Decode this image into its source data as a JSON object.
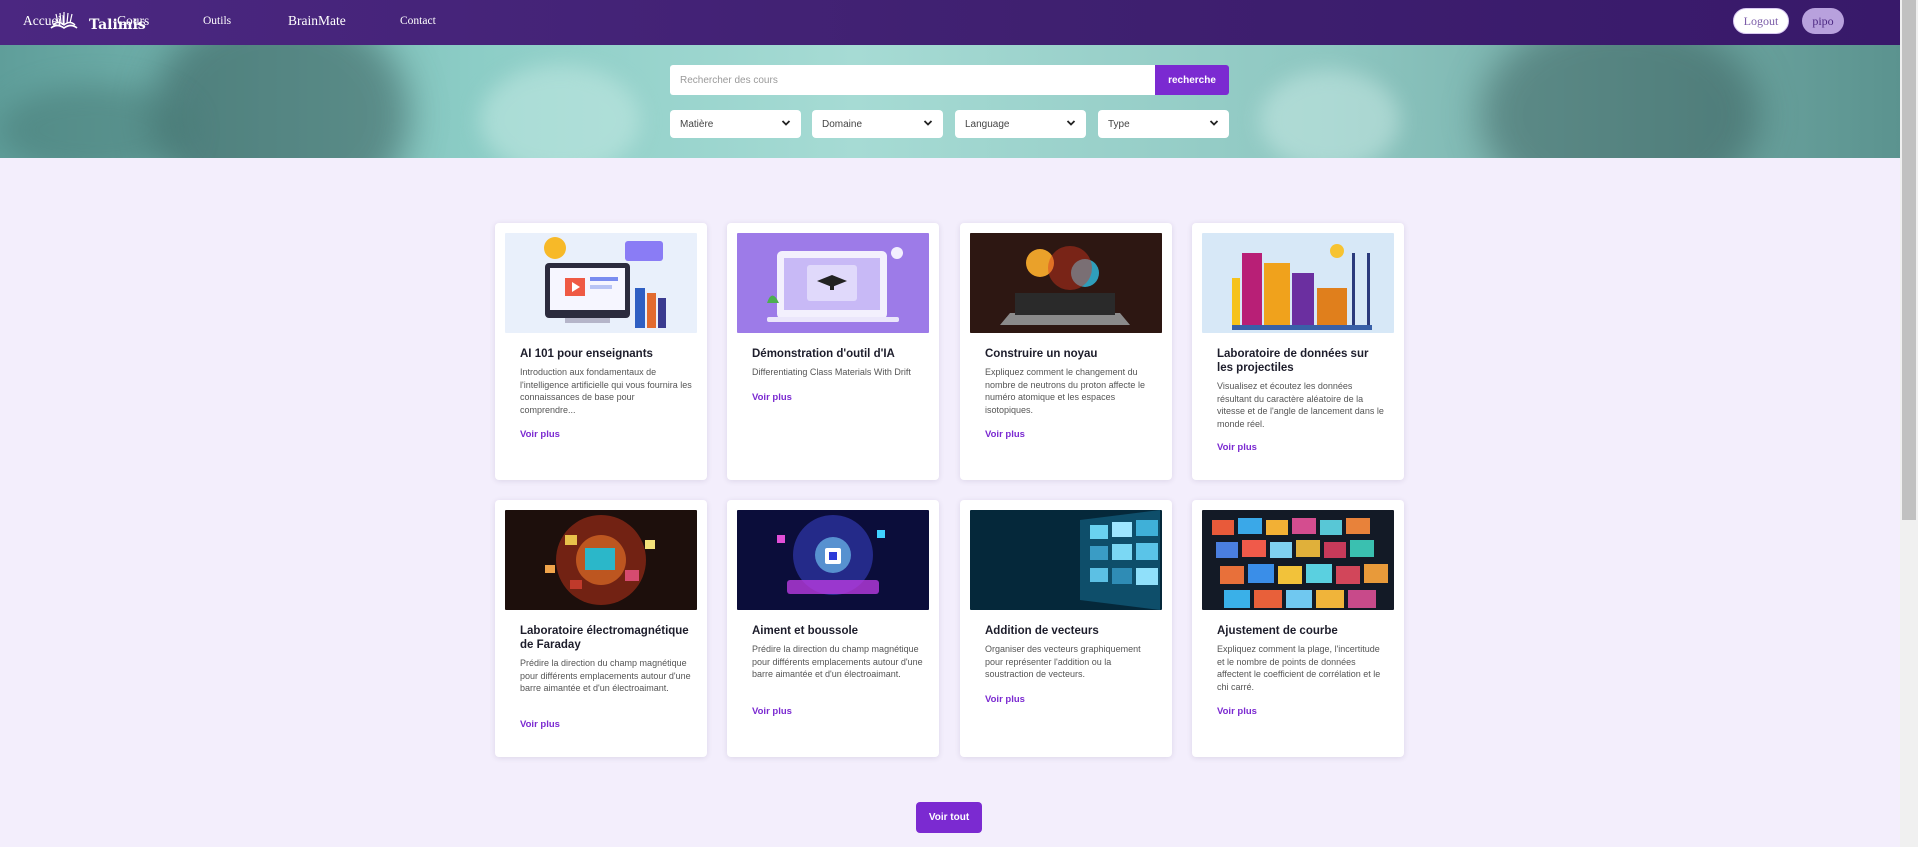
{
  "brand": {
    "name": "Talimis",
    "logo_icon": "book-icon"
  },
  "nav": {
    "items": [
      {
        "label": "Accueil",
        "size": "big"
      },
      {
        "label": "Cours",
        "size": "big"
      },
      {
        "label": "Outils",
        "size": "small"
      },
      {
        "label": "BrainMate",
        "size": "big"
      },
      {
        "label": "Contact",
        "size": "small"
      }
    ],
    "logout_label": "Logout",
    "user_label": "pipo"
  },
  "search": {
    "placeholder": "Rechercher des cours",
    "button_label": "recherche"
  },
  "filters": [
    {
      "label": "Matière",
      "icon": "chevron-down-icon"
    },
    {
      "label": "Domaine",
      "icon": "chevron-down-icon"
    },
    {
      "label": "Language",
      "icon": "chevron-down-icon"
    },
    {
      "label": "Type",
      "icon": "chevron-down-icon"
    }
  ],
  "courses": [
    {
      "title": "AI 101 pour enseignants",
      "description": "Introduction aux fondamentaux de l'intelligence artificielle qui vous fournira les connaissances de base pour comprendre...",
      "link": "Voir plus"
    },
    {
      "title": "Démonstration d'outil d'IA",
      "description": "Differentiating Class Materials With Drift",
      "link": "Voir plus"
    },
    {
      "title": "Construire un noyau",
      "description": "Expliquez comment le changement du nombre de neutrons du proton affecte le numéro atomique et les espaces isotopiques.",
      "link": "Voir plus"
    },
    {
      "title": "Laboratoire de données sur les projectiles",
      "description": "Visualisez et écoutez les données résultant du caractère aléatoire de la vitesse et de l'angle de lancement dans le monde réel.",
      "link": "Voir plus"
    },
    {
      "title": "Laboratoire électromagnétique de Faraday",
      "description": "Prédire la direction du champ magnétique pour différents emplacements autour d'une barre aimantée et d'un électroaimant.",
      "link": "Voir plus"
    },
    {
      "title": "Aiment et boussole",
      "description": "Prédire la direction du champ magnétique pour différents emplacements autour d'une barre aimantée et d'un électroaimant.",
      "link": "Voir plus"
    },
    {
      "title": "Addition de vecteurs",
      "description": "Organiser des vecteurs graphiquement pour représenter l'addition ou la soustraction de vecteurs.",
      "link": "Voir plus"
    },
    {
      "title": "Ajustement de courbe",
      "description": "Expliquez comment la plage, l'incertitude et le nombre de points de données affectent le coefficient de corrélation et le chi carré.",
      "link": "Voir plus"
    }
  ],
  "voir_tout_label": "Voir tout",
  "colors": {
    "nav": "#412073",
    "accent": "#7b2ad1",
    "page_bg": "#f3eefc"
  }
}
